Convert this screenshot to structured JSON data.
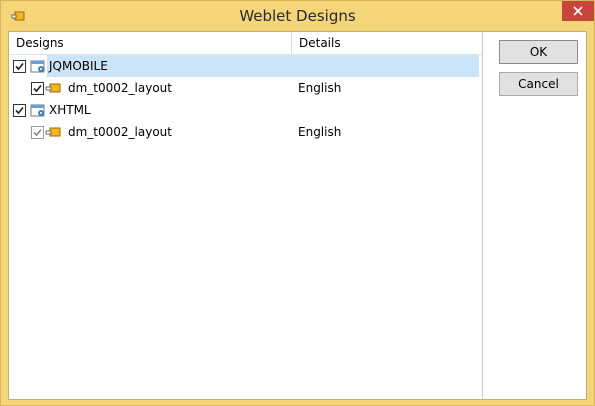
{
  "window": {
    "title": "Weblet Designs"
  },
  "columns": {
    "designs": "Designs",
    "details": "Details"
  },
  "rows": [
    {
      "label": "JQMOBILE",
      "details": "",
      "checked": true,
      "selected": true,
      "icon": "design-group-icon"
    },
    {
      "label": "dm_t0002_layout",
      "details": "English",
      "checked": true,
      "selected": false,
      "icon": "folder-icon"
    },
    {
      "label": "XHTML",
      "details": "",
      "checked": true,
      "selected": false,
      "icon": "design-group-icon"
    },
    {
      "label": "dm_t0002_layout",
      "details": "English",
      "checked": true,
      "selected": false,
      "icon": "folder-icon"
    }
  ],
  "buttons": {
    "ok": "OK",
    "cancel": "Cancel"
  },
  "colors": {
    "frame": "#f5d57a",
    "close": "#c7453c",
    "selection": "#cce4f7"
  }
}
